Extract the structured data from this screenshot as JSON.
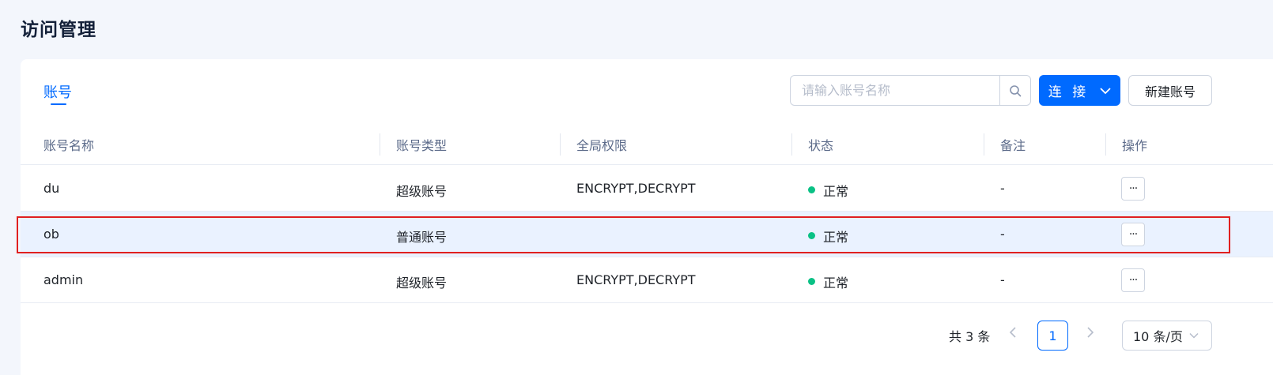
{
  "page": {
    "title": "访问管理"
  },
  "tabs": [
    {
      "label": "账号",
      "active": true
    }
  ],
  "toolbar": {
    "search_placeholder": "请输入账号名称",
    "search_value": "",
    "connect_label": "连 接",
    "new_account_label": "新建账号"
  },
  "table": {
    "columns": [
      "账号名称",
      "账号类型",
      "全局权限",
      "状态",
      "备注",
      "操作"
    ],
    "rows": [
      {
        "name": "du",
        "type": "超级账号",
        "privileges": "ENCRYPT,DECRYPT",
        "status": "正常",
        "remark": "-",
        "action": "···"
      },
      {
        "name": "ob",
        "type": "普通账号",
        "privileges": "",
        "status": "正常",
        "remark": "-",
        "action": "···",
        "selected": true
      },
      {
        "name": "admin",
        "type": "超级账号",
        "privileges": "ENCRYPT,DECRYPT",
        "status": "正常",
        "remark": "-",
        "action": "···"
      }
    ]
  },
  "pagination": {
    "total_text": "共 3 条",
    "prev_icon": "chevron-left-icon",
    "current_page": "1",
    "next_icon": "chevron-right-icon",
    "page_size": "10 条/页"
  },
  "colors": {
    "accent": "#006aff",
    "status_ok": "#0ac185",
    "highlight": "#e02020",
    "selected_row": "#eaf2ff"
  }
}
